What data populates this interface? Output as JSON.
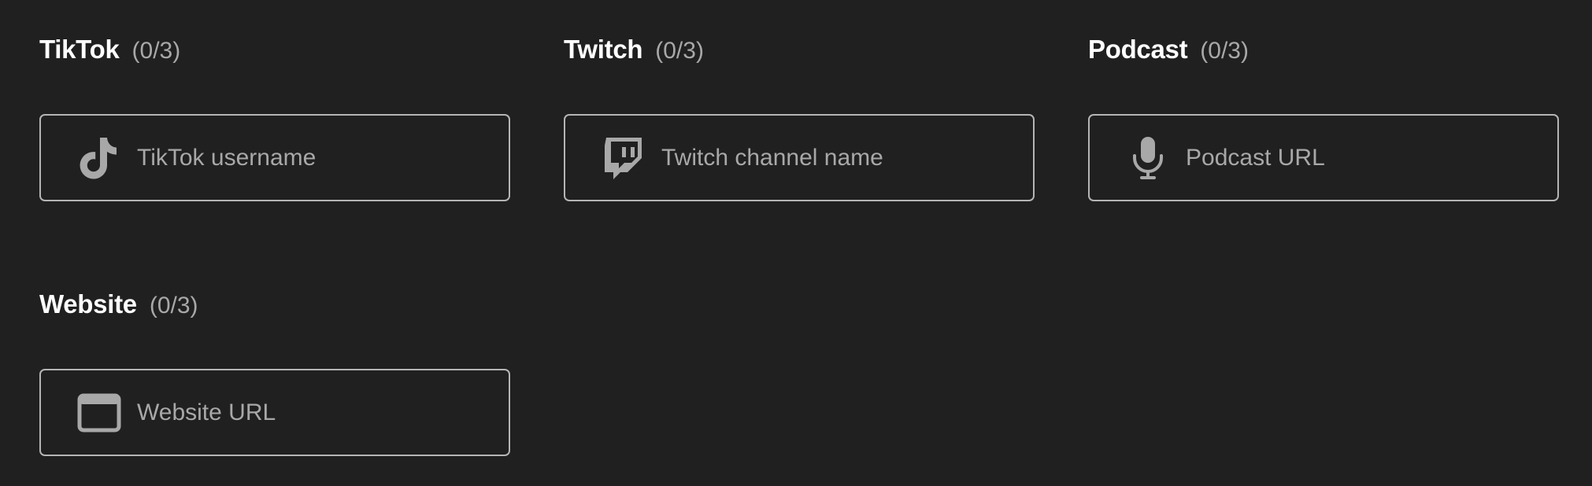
{
  "sections": [
    {
      "title": "TikTok",
      "count": "(0/3)",
      "placeholder": "TikTok username",
      "icon": "tiktok-icon"
    },
    {
      "title": "Twitch",
      "count": "(0/3)",
      "placeholder": "Twitch channel name",
      "icon": "twitch-icon"
    },
    {
      "title": "Podcast",
      "count": "(0/3)",
      "placeholder": "Podcast URL",
      "icon": "microphone-icon"
    },
    {
      "title": "Website",
      "count": "(0/3)",
      "placeholder": "Website URL",
      "icon": "browser-window-icon"
    }
  ],
  "colors": {
    "background": "#202020",
    "title": "#ffffff",
    "muted": "#a8a8a8",
    "border": "#b5b5b5"
  }
}
